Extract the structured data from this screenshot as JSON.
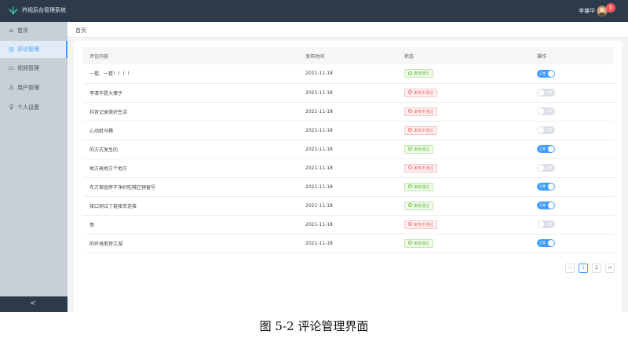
{
  "app": {
    "title": "衿视后台管理系统"
  },
  "header": {
    "user_name": "李墉华",
    "notification_count": "5"
  },
  "sidebar": {
    "items": [
      {
        "label": "首页",
        "icon": "home-icon"
      },
      {
        "label": "评论管理",
        "icon": "comment-icon",
        "active": true
      },
      {
        "label": "视频管理",
        "icon": "video-icon"
      },
      {
        "label": "用户管理",
        "icon": "users-icon"
      },
      {
        "label": "个人设置",
        "icon": "person-icon"
      }
    ],
    "collapse_glyph": "<"
  },
  "breadcrumb": {
    "current": "首页"
  },
  "table": {
    "columns": [
      "评论内容",
      "发布时间",
      "状态",
      "操作"
    ],
    "rows": [
      {
        "content": "一楼、一楼！！！！",
        "time": "2021-11-18",
        "status": "审核通过",
        "passed": true,
        "switch": "正常",
        "on": true
      },
      {
        "content": "李清华是大傻子",
        "time": "2021-11-18",
        "status": "审核不通过",
        "passed": false,
        "switch": "封禁",
        "on": false
      },
      {
        "content": "抖音记录美好生活",
        "time": "2021-11-18",
        "status": "审核不通过",
        "passed": false,
        "switch": "封禁",
        "on": false
      },
      {
        "content": "心动就马桶",
        "time": "2021-11-18",
        "status": "审核不通过",
        "passed": false,
        "switch": "封禁",
        "on": false
      },
      {
        "content": "的方式发生的",
        "time": "2021-11-18",
        "status": "审核通过",
        "passed": true,
        "switch": "正常",
        "on": true
      },
      {
        "content": "地方高地方个地方",
        "time": "2021-11-18",
        "status": "审核不通过",
        "passed": false,
        "switch": "封禁",
        "on": false
      },
      {
        "content": "东方家园停干净好吃哦已预留号",
        "time": "2021-11-18",
        "status": "审核通过",
        "passed": true,
        "switch": "正常",
        "on": true
      },
      {
        "content": "接口测试了链接幸连接",
        "time": "2021-11-18",
        "status": "审核通过",
        "passed": true,
        "switch": "正常",
        "on": true
      },
      {
        "content": "哥",
        "time": "2021-11-18",
        "status": "审核不通过",
        "passed": false,
        "switch": "封禁",
        "on": false
      },
      {
        "content": "的环境愈挤江湖",
        "time": "2021-11-18",
        "status": "审核通过",
        "passed": true,
        "switch": "正常",
        "on": true
      }
    ]
  },
  "pagination": {
    "prev": "<",
    "pages": [
      "1",
      "2"
    ],
    "current": "1",
    "next": ">"
  },
  "caption": "图 5-2  评论管理界面",
  "colors": {
    "header_bg": "#2d3a4b",
    "sidebar_bg": "#c9cfd7",
    "accent": "#409eff",
    "pass": "#67c23a",
    "fail": "#f56c6c"
  }
}
